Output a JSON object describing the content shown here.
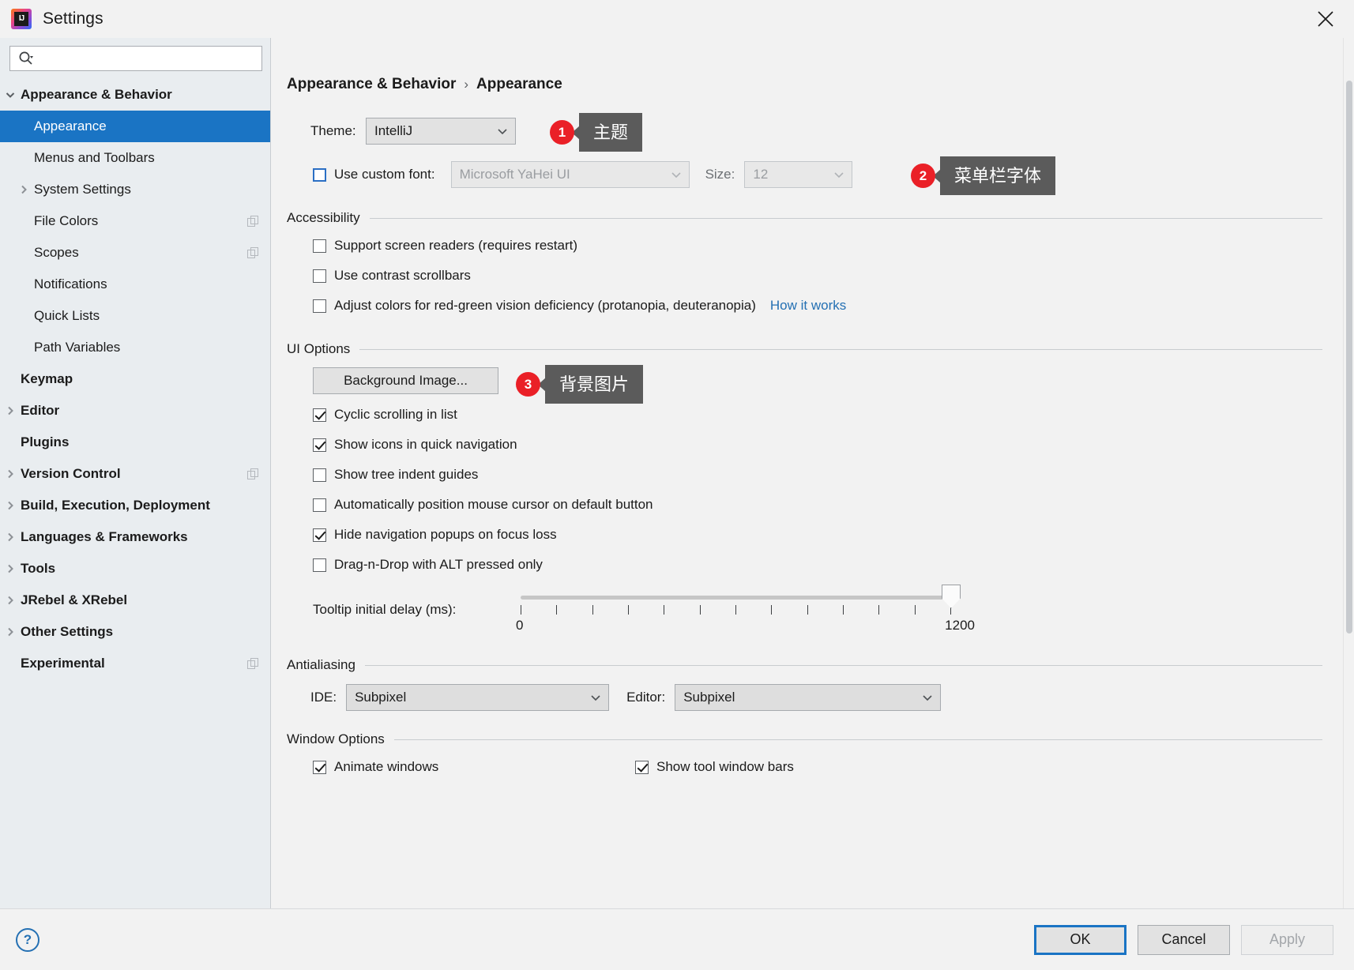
{
  "window": {
    "title": "Settings",
    "app_icon": "intellij-idea-icon",
    "close_icon": "close-icon"
  },
  "sidebar": {
    "search": {
      "value": "",
      "placeholder": "",
      "icon": "search-icon"
    },
    "items": [
      {
        "label": "Appearance & Behavior",
        "level": 0,
        "bold": true,
        "arrow": "chevron-down",
        "selected": false,
        "badge": false
      },
      {
        "label": "Appearance",
        "level": 1,
        "bold": false,
        "arrow": "none",
        "selected": true,
        "badge": false
      },
      {
        "label": "Menus and Toolbars",
        "level": 1,
        "bold": false,
        "arrow": "none",
        "selected": false,
        "badge": false
      },
      {
        "label": "System Settings",
        "level": 1,
        "bold": false,
        "arrow": "chevron-right",
        "selected": false,
        "badge": false
      },
      {
        "label": "File Colors",
        "level": 1,
        "bold": false,
        "arrow": "none",
        "selected": false,
        "badge": true
      },
      {
        "label": "Scopes",
        "level": 1,
        "bold": false,
        "arrow": "none",
        "selected": false,
        "badge": true
      },
      {
        "label": "Notifications",
        "level": 1,
        "bold": false,
        "arrow": "none",
        "selected": false,
        "badge": false
      },
      {
        "label": "Quick Lists",
        "level": 1,
        "bold": false,
        "arrow": "none",
        "selected": false,
        "badge": false
      },
      {
        "label": "Path Variables",
        "level": 1,
        "bold": false,
        "arrow": "none",
        "selected": false,
        "badge": false
      },
      {
        "label": "Keymap",
        "level": 0,
        "bold": true,
        "arrow": "none",
        "selected": false,
        "badge": false
      },
      {
        "label": "Editor",
        "level": 0,
        "bold": true,
        "arrow": "chevron-right",
        "selected": false,
        "badge": false
      },
      {
        "label": "Plugins",
        "level": 0,
        "bold": true,
        "arrow": "none",
        "selected": false,
        "badge": false
      },
      {
        "label": "Version Control",
        "level": 0,
        "bold": true,
        "arrow": "chevron-right",
        "selected": false,
        "badge": true
      },
      {
        "label": "Build, Execution, Deployment",
        "level": 0,
        "bold": true,
        "arrow": "chevron-right",
        "selected": false,
        "badge": false
      },
      {
        "label": "Languages & Frameworks",
        "level": 0,
        "bold": true,
        "arrow": "chevron-right",
        "selected": false,
        "badge": false
      },
      {
        "label": "Tools",
        "level": 0,
        "bold": true,
        "arrow": "chevron-right",
        "selected": false,
        "badge": false
      },
      {
        "label": "JRebel & XRebel",
        "level": 0,
        "bold": true,
        "arrow": "chevron-right",
        "selected": false,
        "badge": false
      },
      {
        "label": "Other Settings",
        "level": 0,
        "bold": true,
        "arrow": "chevron-right",
        "selected": false,
        "badge": false
      },
      {
        "label": "Experimental",
        "level": 0,
        "bold": true,
        "arrow": "none",
        "selected": false,
        "badge": true
      }
    ]
  },
  "breadcrumb": {
    "root": "Appearance & Behavior",
    "separator": "›",
    "current": "Appearance"
  },
  "theme_row": {
    "label": "Theme:",
    "value": "IntelliJ"
  },
  "font_row": {
    "checkbox_label": "Use custom font:",
    "checked": false,
    "font_value": "Microsoft YaHei UI",
    "size_label": "Size:",
    "size_value": "12"
  },
  "accessibility": {
    "title": "Accessibility",
    "options": [
      {
        "label": "Support screen readers (requires restart)",
        "checked": false
      },
      {
        "label": "Use contrast scrollbars",
        "checked": false
      },
      {
        "label": "Adjust colors for red-green vision deficiency (protanopia, deuteranopia)",
        "checked": false
      }
    ],
    "link": "How it works"
  },
  "ui_options": {
    "title": "UI Options",
    "background_image_button": "Background Image...",
    "options": [
      {
        "label": "Cyclic scrolling in list",
        "checked": true
      },
      {
        "label": "Show icons in quick navigation",
        "checked": true
      },
      {
        "label": "Show tree indent guides",
        "checked": false
      },
      {
        "label": "Automatically position mouse cursor on default button",
        "checked": false
      },
      {
        "label": "Hide navigation popups on focus loss",
        "checked": true
      },
      {
        "label": "Drag-n-Drop with ALT pressed only",
        "checked": false
      }
    ],
    "slider": {
      "label": "Tooltip initial delay (ms):",
      "min_label": "0",
      "max_label": "1200",
      "min": 0,
      "max": 1200,
      "value": 1200,
      "tick_count": 13
    }
  },
  "antialiasing": {
    "title": "Antialiasing",
    "ide_label": "IDE:",
    "ide_value": "Subpixel",
    "editor_label": "Editor:",
    "editor_value": "Subpixel"
  },
  "window_options": {
    "title": "Window Options",
    "left": [
      {
        "label": "Animate windows",
        "checked": true
      }
    ],
    "right": [
      {
        "label": "Show tool window bars",
        "checked": true
      }
    ]
  },
  "annotations": [
    {
      "num": "1",
      "text": "主题"
    },
    {
      "num": "2",
      "text": "菜单栏字体"
    },
    {
      "num": "3",
      "text": "背景图片"
    }
  ],
  "footer": {
    "help": "?",
    "ok": "OK",
    "cancel": "Cancel",
    "apply": "Apply"
  },
  "colors": {
    "accent_blue": "#1a74c4",
    "annotation_red": "#ea2027",
    "bubble_gray": "#5b5b5b",
    "link_blue": "#2470b3"
  }
}
